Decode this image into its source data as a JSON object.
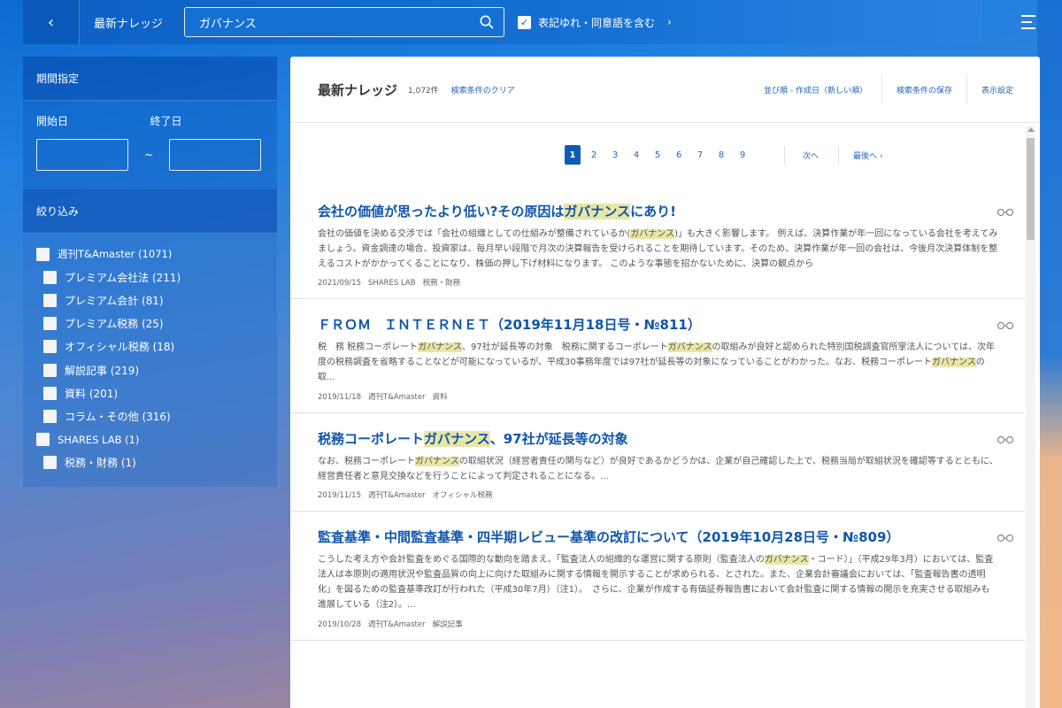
{
  "topbar": {
    "back_label": "‹",
    "title": "最新ナレッジ",
    "search_value": "ガバナンス",
    "synonym_label": "表記ゆれ・同意語を含む",
    "synonym_checked": true,
    "synonym_arrow": "›"
  },
  "sidebar": {
    "period_heading": "期間指定",
    "start_label": "開始日",
    "end_label": "終了日",
    "tilde": "~",
    "filter_heading": "絞り込み",
    "filters": [
      {
        "label": "週刊T&Amaster (1071)",
        "level": 1
      },
      {
        "label": "プレミアム会社法 (211)",
        "level": 2
      },
      {
        "label": "プレミアム会計 (81)",
        "level": 2
      },
      {
        "label": "プレミアム税務 (25)",
        "level": 2
      },
      {
        "label": "オフィシャル税務 (18)",
        "level": 2
      },
      {
        "label": "解説記事 (219)",
        "level": 2
      },
      {
        "label": "資料 (201)",
        "level": 2
      },
      {
        "label": "コラム・その他 (316)",
        "level": 2
      },
      {
        "label": "SHARES LAB (1)",
        "level": 1
      },
      {
        "label": "税務・財務 (1)",
        "level": 2
      }
    ]
  },
  "main": {
    "title": "最新ナレッジ",
    "count": "1,072件",
    "clear_link": "検索条件のクリア",
    "sort_label": "並び順 - 作成日（新しい順）",
    "save_label": "検索条件の保存",
    "display_label": "表示設定"
  },
  "pagination": {
    "pages": [
      "1",
      "2",
      "3",
      "4",
      "5",
      "6",
      "7",
      "8",
      "9"
    ],
    "active": "1",
    "next_label": "次へ",
    "last_label": "最後へ ›"
  },
  "articles": [
    {
      "title_parts": [
        "会社の価値が思ったより低い?その原因は",
        "ガバナンス",
        "にあり!"
      ],
      "body_parts": [
        "会社の価値を決める交渉では「会社の組織としての仕組みが整備されているか(",
        "ガバナンス",
        ")」も大きく影響します。 例えば、決算作業が年一回になっている会社を考えてみましょう。資金調達の場合、投資家は、毎月早い段階で月次の決算報告を受けられることを期待しています。そのため、決算作業が年一回の会社は、今後月次決算体制を整えるコストがかかってくることになり、株価の押し下げ材料になります。 このような事態を招かないために、決算の観点から"
      ],
      "date": "2021/09/15",
      "source": "SHARES LAB",
      "category": "税務・財務"
    },
    {
      "title_parts": [
        "ＦＲＯＭ　ＩＮＴＥＲＮＥＴ（2019年11月18日号・№811）",
        "",
        ""
      ],
      "body_parts": [
        "税　務 税務コーポレート",
        "ガバナンス",
        "、97社が延長等の対象　税務に関するコーポレート",
        "ガバナンス",
        "の取組みが良好と認められた特別国税調査官所掌法人については、次年度の税務調査を省略することなどが可能になっているが、平成30事務年度では97社が延長等の対象になっていることがわかった。なお、税務コーポレート",
        "ガバナンス",
        "の取..."
      ],
      "date": "2019/11/18",
      "source": "週刊T&Amaster",
      "category": "資料"
    },
    {
      "title_parts": [
        "税務コーポレート",
        "ガバナンス",
        "、97社が延長等の対象"
      ],
      "body_parts": [
        "なお、税務コーポレート",
        "ガバナンス",
        "の取組状況（経営者責任の関与など）が良好であるかどうかは、企業が自己確認した上で、税務当局が取組状況を確認等するとともに、経営責任者と意見交換などを行うことによって判定されることになる。..."
      ],
      "date": "2019/11/15",
      "source": "週刊T&Amaster",
      "category": "オフィシャル税務"
    },
    {
      "title_parts": [
        "監査基準・中間監査基準・四半期レビュー基準の改訂について（2019年10月28日号・№809）",
        "",
        ""
      ],
      "body_parts": [
        "こうした考え方や会計監査をめぐる国際的な動向を踏まえ、「監査法人の組織的な運営に関する原則（監査法人の",
        "ガバナンス",
        "・コード）」（平成29年3月）においては、監査法人は本原則の適用状況や監査品質の向上に向けた取組みに関する情報を開示することが求められる、とされた。また、企業会計審議会においては、「監査報告書の透明化」を図るための監査基準改訂が行われた（平成30年7月）（注1）。　さらに、企業が作成する有価証券報告書において会計監査に関する情報の開示を充実させる取組みも進展している（注2）。..."
      ],
      "date": "2019/10/28",
      "source": "週刊T&Amaster",
      "category": "解説記事"
    }
  ]
}
